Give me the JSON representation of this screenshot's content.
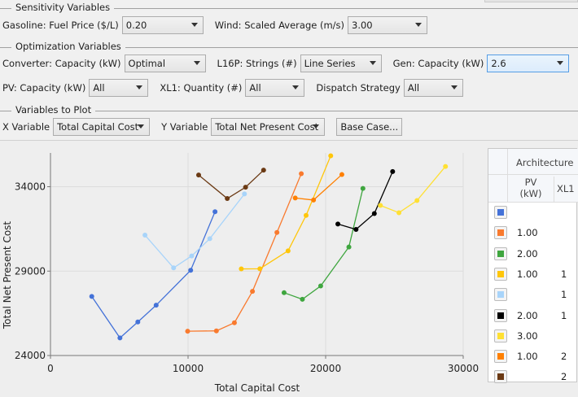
{
  "sensitivity": {
    "title": "Sensitivity Variables",
    "fuel_label": "Gasoline: Fuel Price ($/L)",
    "fuel_value": "0.20",
    "wind_label": "Wind: Scaled Average (m/s)",
    "wind_value": "3.00"
  },
  "optimization": {
    "title": "Optimization Variables",
    "converter_label": "Converter: Capacity (kW)",
    "converter_value": "Optimal",
    "strings_label": "L16P: Strings (#)",
    "strings_value": "Line Series",
    "gen_label": "Gen: Capacity (kW)",
    "gen_value": "2.6",
    "pv_label": "PV: Capacity (kW)",
    "pv_value": "All",
    "xl1_label": "XL1: Quantity (#)",
    "xl1_value": "All",
    "dispatch_label": "Dispatch Strategy",
    "dispatch_value": "All"
  },
  "plotvars": {
    "title": "Variables to Plot",
    "x_label": "X Variable",
    "x_value": "Total Capital Cost",
    "y_label": "Y Variable",
    "y_value": "Total Net Present Cost",
    "base_case": "Base Case..."
  },
  "legend": {
    "header": "Architecture",
    "pv_header_1": "PV",
    "pv_header_2": "(kW)",
    "xl1_header": "XL1",
    "rows": [
      {
        "color": "#4472d8",
        "pv": "",
        "xl1": ""
      },
      {
        "color": "#f97a2e",
        "pv": "1.00",
        "xl1": ""
      },
      {
        "color": "#3fa63f",
        "pv": "2.00",
        "xl1": ""
      },
      {
        "color": "#ffc60a",
        "pv": "1.00",
        "xl1": "1"
      },
      {
        "color": "#a8d4fa",
        "pv": "",
        "xl1": "1"
      },
      {
        "color": "#000000",
        "pv": "2.00",
        "xl1": "1"
      },
      {
        "color": "#ffe033",
        "pv": "3.00",
        "xl1": ""
      },
      {
        "color": "#ff8000",
        "pv": "1.00",
        "xl1": "2"
      },
      {
        "color": "#6b3a14",
        "pv": "",
        "xl1": "2"
      }
    ]
  },
  "chart_data": {
    "type": "line",
    "xlabel": "Total Capital Cost",
    "ylabel": "Total Net Present Cost",
    "xlim": [
      0,
      30000
    ],
    "ylim": [
      24000,
      36000
    ],
    "xticks": [
      "0",
      "10000",
      "20000",
      "30000"
    ],
    "yticks": [
      "24000",
      "29000",
      "34000"
    ],
    "grid": true,
    "legend_placement": "right",
    "series": [
      {
        "color": "#4472d8",
        "points": [
          [
            3000,
            27500
          ],
          [
            5050,
            25040
          ],
          [
            6350,
            25990
          ],
          [
            7680,
            26980
          ],
          [
            10190,
            29050
          ],
          [
            11960,
            32520
          ]
        ]
      },
      {
        "color": "#f97a2e",
        "points": [
          [
            9970,
            25440
          ],
          [
            12060,
            25460
          ],
          [
            13370,
            25940
          ],
          [
            14680,
            27800
          ],
          [
            16460,
            31290
          ],
          [
            18230,
            34770
          ]
        ]
      },
      {
        "color": "#3fa63f",
        "points": [
          [
            16980,
            27720
          ],
          [
            18310,
            27330
          ],
          [
            19640,
            28120
          ],
          [
            21690,
            30430
          ],
          [
            22710,
            33900
          ]
        ]
      },
      {
        "color": "#ffc60a",
        "points": [
          [
            13870,
            29130
          ],
          [
            15220,
            29140
          ],
          [
            17270,
            30200
          ],
          [
            18580,
            32300
          ],
          [
            20370,
            35830
          ]
        ]
      },
      {
        "color": "#a8d4fa",
        "points": [
          [
            6870,
            31130
          ],
          [
            8950,
            29190
          ],
          [
            10260,
            29900
          ],
          [
            11580,
            30920
          ],
          [
            14100,
            33570
          ]
        ]
      },
      {
        "color": "#000000",
        "points": [
          [
            20890,
            31790
          ],
          [
            22210,
            31470
          ],
          [
            23540,
            32410
          ],
          [
            24870,
            34900
          ]
        ]
      },
      {
        "color": "#ffe033",
        "points": [
          [
            23980,
            32890
          ],
          [
            25330,
            32460
          ],
          [
            26640,
            33180
          ],
          [
            28710,
            35200
          ]
        ]
      },
      {
        "color": "#ff8000",
        "points": [
          [
            17790,
            33330
          ],
          [
            19120,
            33210
          ],
          [
            21180,
            34720
          ]
        ]
      },
      {
        "color": "#6b3a14",
        "points": [
          [
            10770,
            34690
          ],
          [
            12850,
            33300
          ],
          [
            14180,
            33970
          ],
          [
            15490,
            34980
          ]
        ]
      }
    ]
  }
}
